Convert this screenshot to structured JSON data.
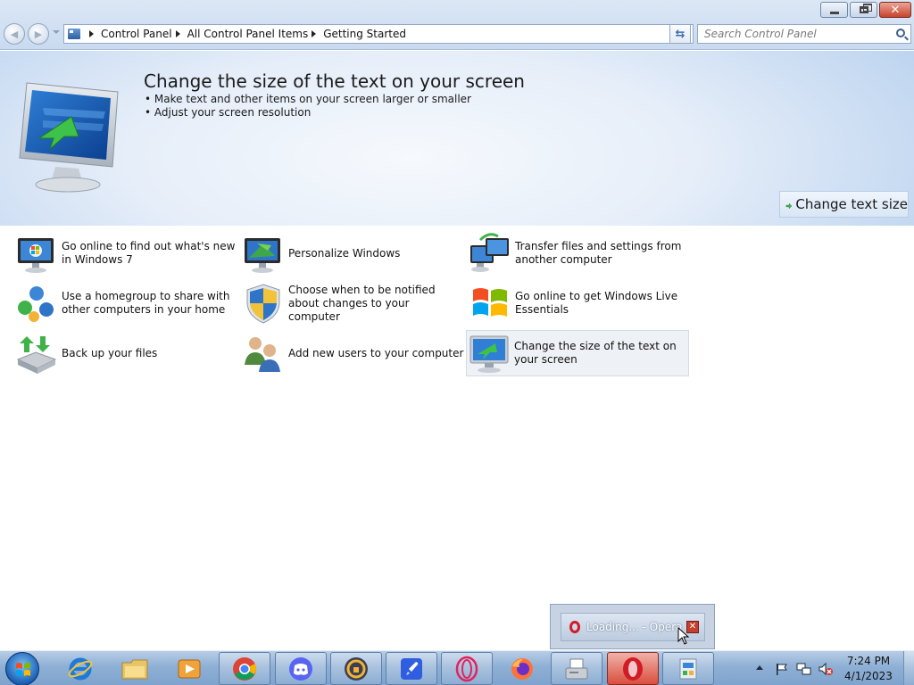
{
  "window": {
    "breadcrumbs": [
      "Control Panel",
      "All Control Panel Items",
      "Getting Started"
    ],
    "search_placeholder": "Search Control Panel"
  },
  "banner": {
    "title": "Change the size of the text on your screen",
    "bullets": [
      "Make text and other items on your screen larger or smaller",
      "Adjust your screen resolution"
    ],
    "button_label": "Change text size"
  },
  "tasks": [
    {
      "label": "Go online to find out what's new in Windows 7",
      "icon": "windows-monitor-icon"
    },
    {
      "label": "Personalize Windows",
      "icon": "personalize-monitor-icon"
    },
    {
      "label": "Transfer files and settings from another computer",
      "icon": "transfer-computers-icon"
    },
    {
      "label": "Use a homegroup to share with other computers in your home",
      "icon": "homegroup-icon"
    },
    {
      "label": "Choose when to be notified about changes to your computer",
      "icon": "uac-shield-icon"
    },
    {
      "label": "Go online to get Windows Live Essentials",
      "icon": "windows-logo-icon"
    },
    {
      "label": "Back up your files",
      "icon": "backup-drive-icon"
    },
    {
      "label": "Add new users to your computer",
      "icon": "users-icon"
    },
    {
      "label": "Change the size of the text on your screen",
      "icon": "text-size-monitor-icon",
      "selected": true
    }
  ],
  "popup": {
    "label": "Loading... - Opera"
  },
  "taskbar": {
    "apps": [
      "Internet Explorer",
      "Windows Explorer",
      "Media Player",
      "Chrome",
      "Discord",
      "Shield app",
      "Rocket app",
      "Opera GX",
      "Firefox",
      "Fax and Scan",
      "Opera",
      "Control Panel"
    ],
    "time": "7:24 PM",
    "date": "4/1/2023"
  },
  "colors": {
    "accent": "#1a5fb3",
    "opera_red": "#d11b25",
    "banner_blue": "#b7d0ee"
  }
}
